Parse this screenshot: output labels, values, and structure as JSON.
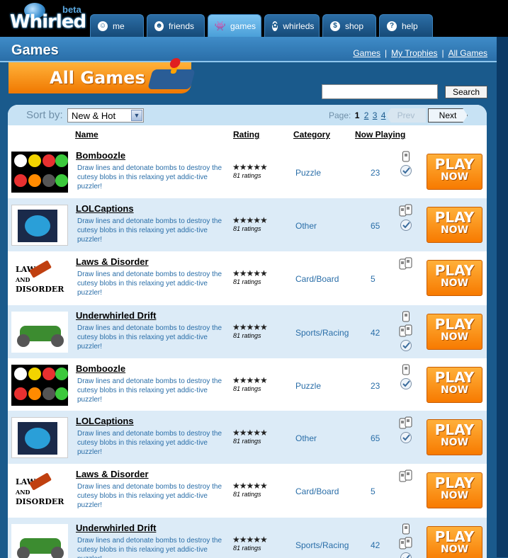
{
  "app": {
    "logo": "Whirled",
    "logo_badge": "beta"
  },
  "nav": {
    "tabs": [
      {
        "label": "me",
        "icon": "me-icon"
      },
      {
        "label": "friends",
        "icon": "friends-icon"
      },
      {
        "label": "games",
        "icon": "games-icon",
        "active": true
      },
      {
        "label": "whirleds",
        "icon": "whirleds-icon"
      },
      {
        "label": "shop",
        "icon": "shop-icon"
      },
      {
        "label": "help",
        "icon": "help-icon"
      }
    ]
  },
  "header": {
    "title": "Games",
    "links": [
      "Games",
      "My Trophies",
      "All Games"
    ]
  },
  "banner": {
    "title": "All Games"
  },
  "search": {
    "value": "",
    "button": "Search"
  },
  "sort": {
    "label": "Sort by:",
    "selected": "New & Hot"
  },
  "pager": {
    "label": "Page:",
    "current": "1",
    "pages": [
      "2",
      "3",
      "4"
    ],
    "prev": "Prev",
    "next": "Next"
  },
  "columns": {
    "name": "Name",
    "rating": "Rating",
    "category": "Category",
    "now_playing": "Now Playing"
  },
  "play_button": {
    "top": "PLAY",
    "bottom": "NOW"
  },
  "games": [
    {
      "name": "Bomboozle",
      "desc": "Draw lines and detonate bombs to destroy the cutesy blobs in this relaxing yet addic-tive puzzler!",
      "stars": "★★★★★",
      "ratings": "81 ratings",
      "category": "Puzzle",
      "playing": "23",
      "thumb": "bomboozle"
    },
    {
      "name": "LOLCaptions",
      "desc": "Draw lines and detonate bombs to destroy the cutesy blobs in this relaxing yet addic-tive puzzler!",
      "stars": "★★★★★",
      "ratings": "81 ratings",
      "category": "Other",
      "playing": "65",
      "thumb": "lolcaptions"
    },
    {
      "name": "Laws & Disorder",
      "desc": "Draw lines and detonate bombs to destroy the cutesy blobs in this relaxing yet addic-tive puzzler!",
      "stars": "★★★★★",
      "ratings": "81 ratings",
      "category": "Card/Board",
      "playing": "5",
      "thumb": "laws"
    },
    {
      "name": "Underwhirled Drift",
      "desc": "Draw lines and detonate bombs to destroy the cutesy blobs in this relaxing yet addic-tive puzzler!",
      "stars": "★★★★★",
      "ratings": "81 ratings",
      "category": "Sports/Racing",
      "playing": "42",
      "thumb": "drift"
    },
    {
      "name": "Bomboozle",
      "desc": "Draw lines and detonate bombs to destroy the cutesy blobs in this relaxing yet addic-tive puzzler!",
      "stars": "★★★★★",
      "ratings": "81 ratings",
      "category": "Puzzle",
      "playing": "23",
      "thumb": "bomboozle"
    },
    {
      "name": "LOLCaptions",
      "desc": "Draw lines and detonate bombs to destroy the cutesy blobs in this relaxing yet addic-tive puzzler!",
      "stars": "★★★★★",
      "ratings": "81 ratings",
      "category": "Other",
      "playing": "65",
      "thumb": "lolcaptions"
    },
    {
      "name": "Laws & Disorder",
      "desc": "Draw lines and detonate bombs to destroy the cutesy blobs in this relaxing yet addic-tive puzzler!",
      "stars": "★★★★★",
      "ratings": "81 ratings",
      "category": "Card/Board",
      "playing": "5",
      "thumb": "laws"
    },
    {
      "name": "Underwhirled Drift",
      "desc": "Draw lines and detonate bombs to destroy the cutesy blobs in this relaxing yet addic-tive puzzler!",
      "stars": "★★★★★",
      "ratings": "81 ratings",
      "category": "Sports/Racing",
      "playing": "42",
      "thumb": "drift"
    }
  ],
  "laws_thumb_text": [
    "LAWS",
    "AND",
    "DISORDER"
  ]
}
